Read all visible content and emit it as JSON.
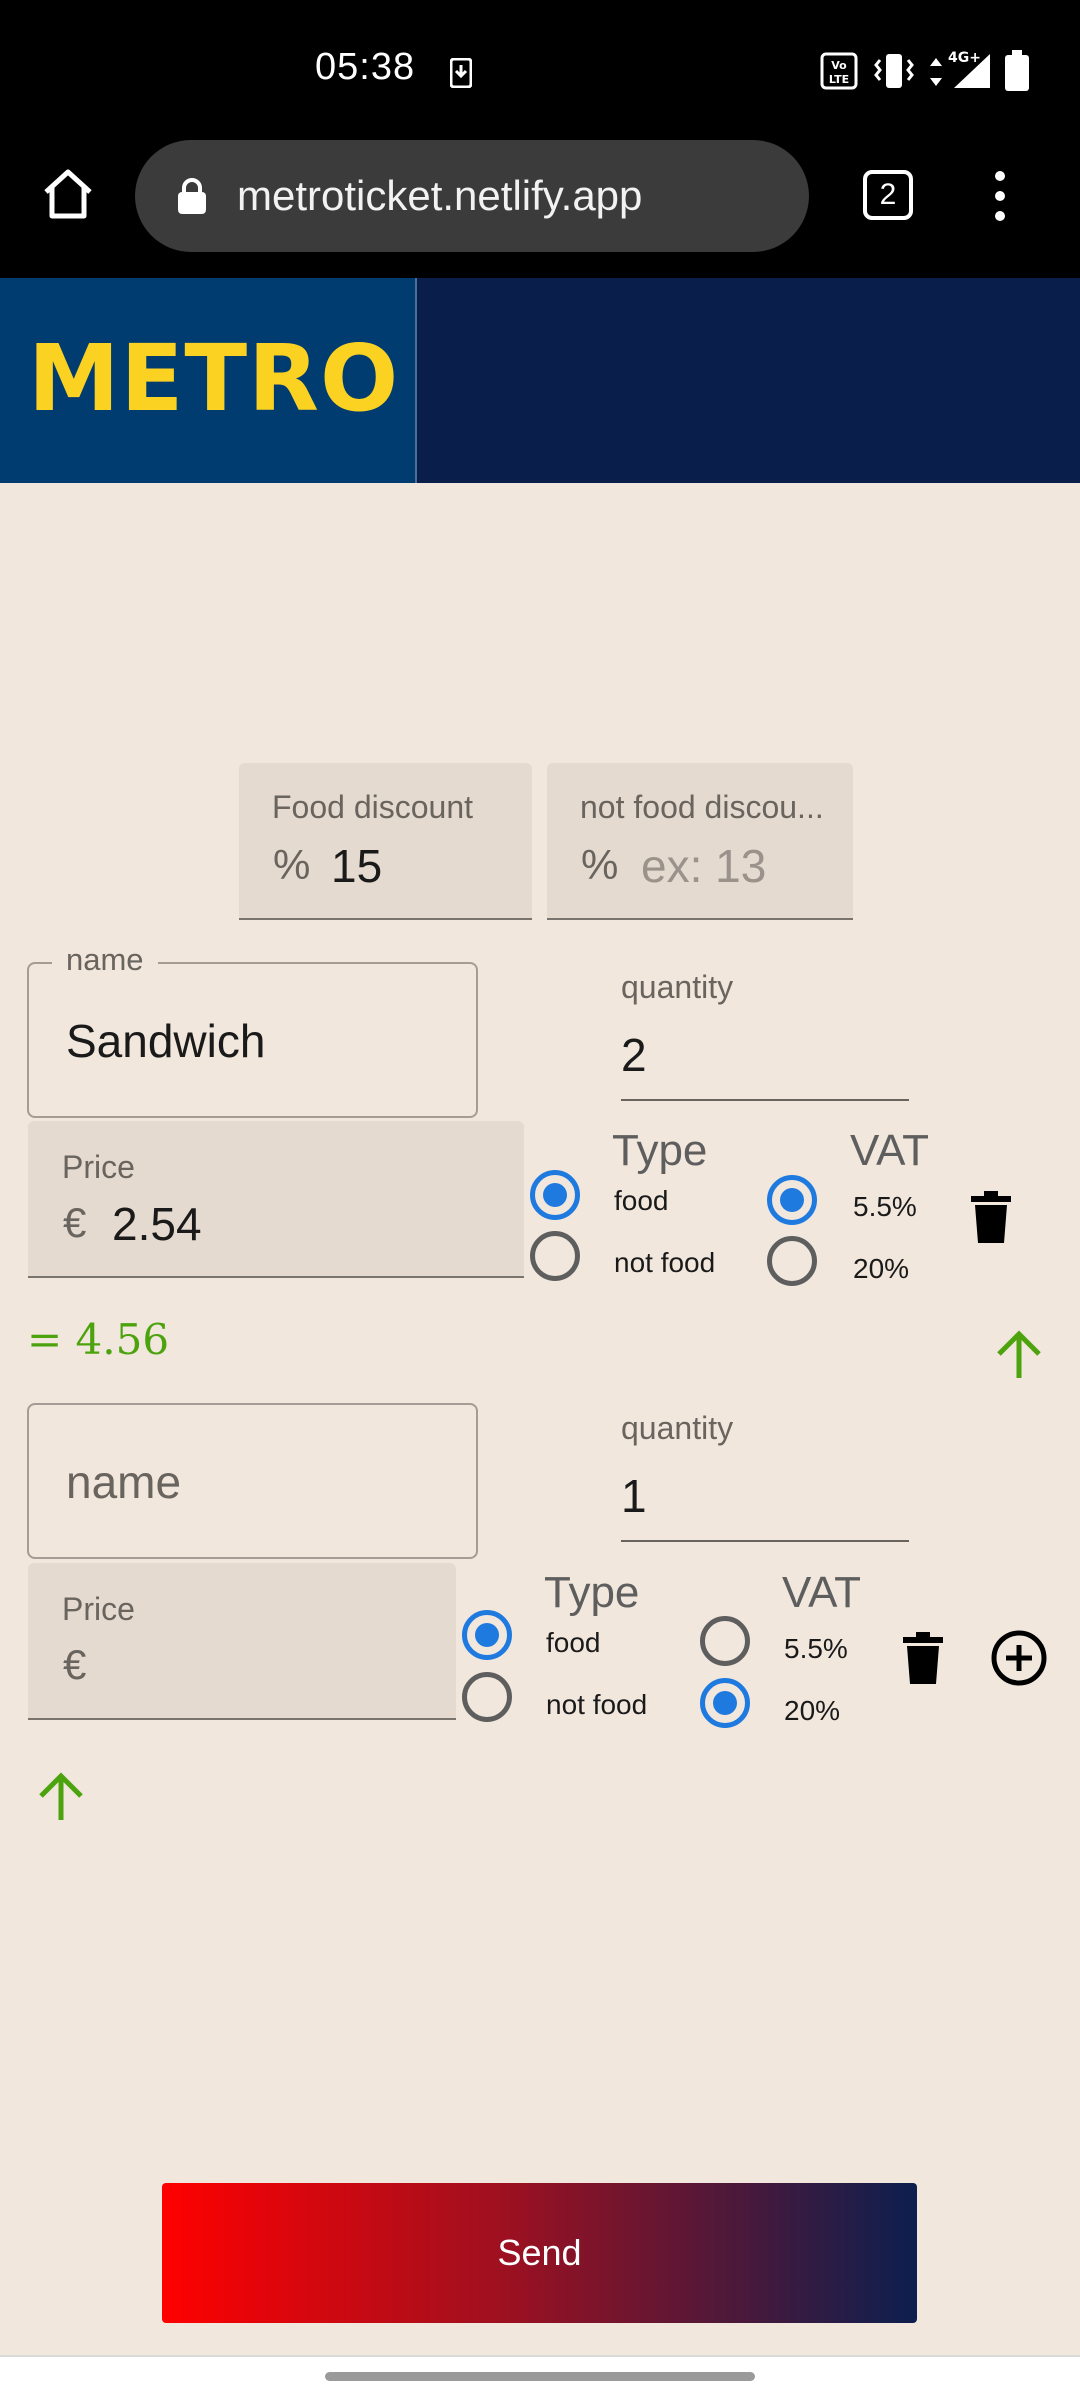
{
  "status_bar": {
    "time": "05:38",
    "icons": [
      "download-icon",
      "volte-icon",
      "vibrate-icon",
      "data-arrows-icon",
      "signal-4g-icon",
      "battery-icon"
    ],
    "network": "4G+"
  },
  "browser": {
    "url": "metroticket.netlify.app",
    "tab_count": "2",
    "icons": [
      "home-icon",
      "lock-icon",
      "tabs-icon",
      "more-vert-icon"
    ]
  },
  "header": {
    "logo_text": "METRO",
    "logo_color": "#fbd221",
    "logo_bg": "#003c70",
    "header_bg": "#0a1e4b"
  },
  "discounts": {
    "food": {
      "label": "Food discount",
      "prefix": "%",
      "value": "15"
    },
    "not_food": {
      "label": "not food discou...",
      "prefix": "%",
      "placeholder": "ex: 13"
    }
  },
  "items": [
    {
      "name_label": "name",
      "name_value": "Sandwich",
      "quantity_label": "quantity",
      "quantity_value": "2",
      "price_label": "Price",
      "price_prefix": "€",
      "price_value": "2.54",
      "type_title": "Type",
      "type_options": [
        "food",
        "not food"
      ],
      "type_selected": "food",
      "vat_title": "VAT",
      "vat_options": [
        "5.5%",
        "20%"
      ],
      "vat_selected": "5.5%",
      "total": "= 4.56"
    },
    {
      "name_placeholder": "name",
      "quantity_label": "quantity",
      "quantity_value": "1",
      "price_label": "Price",
      "price_prefix": "€",
      "price_value": "",
      "type_title": "Type",
      "type_options": [
        "food",
        "not food"
      ],
      "type_selected": "food",
      "vat_title": "VAT",
      "vat_options": [
        "5.5%",
        "20%"
      ],
      "vat_selected": "20%"
    }
  ],
  "send_label": "Send",
  "colors": {
    "accent_green": "#4ca30d",
    "radio_blue": "#1f7ae0",
    "background": "#f1e7dd"
  }
}
